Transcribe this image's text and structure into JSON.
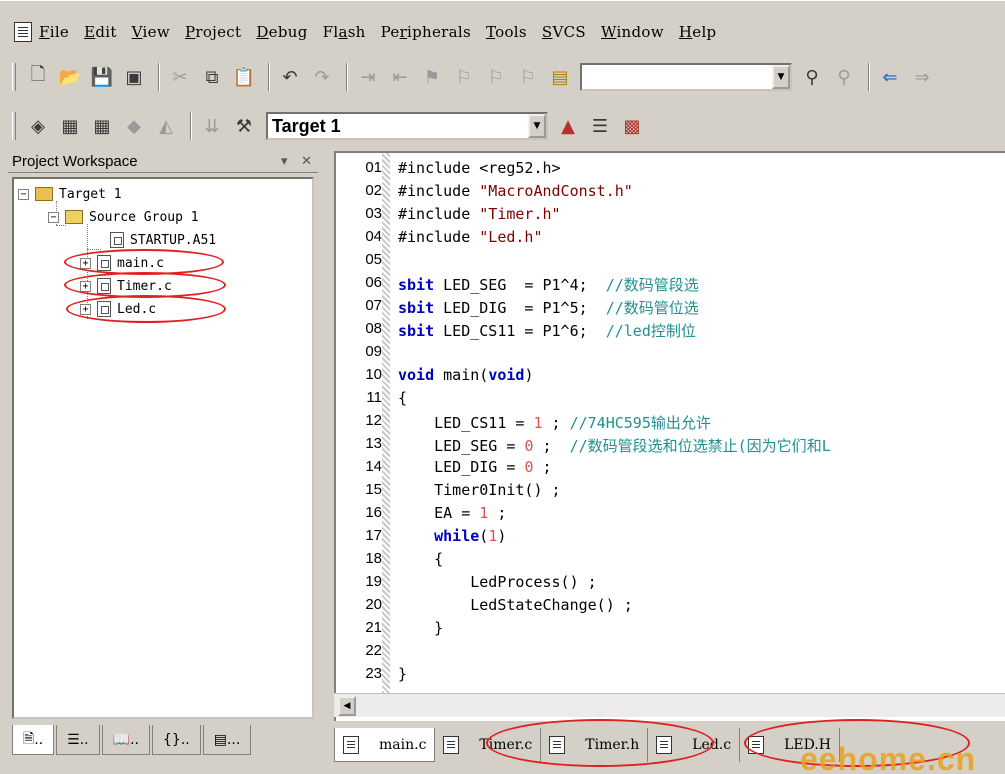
{
  "menu": [
    "File",
    "Edit",
    "View",
    "Project",
    "Debug",
    "Flash",
    "Peripherals",
    "Tools",
    "SVCS",
    "Window",
    "Help"
  ],
  "menu_underline": [
    "F",
    "E",
    "V",
    "P",
    "D",
    "a",
    "r",
    "T",
    "S",
    "W",
    "H"
  ],
  "toolbar2": {
    "target_value": "Target 1"
  },
  "workspace": {
    "title": "Project Workspace",
    "tree": {
      "target": "Target 1",
      "group": "Source Group 1",
      "files": [
        "STARTUP.A51",
        "main.c",
        "Timer.c",
        "Led.c"
      ]
    },
    "tabs": [
      "..",
      "..",
      "..",
      "..",
      "..."
    ]
  },
  "editor": {
    "line_numbers": [
      "01",
      "02",
      "03",
      "04",
      "05",
      "06",
      "07",
      "08",
      "09",
      "10",
      "11",
      "12",
      "13",
      "14",
      "15",
      "16",
      "17",
      "18",
      "19",
      "20",
      "21",
      "22",
      "23"
    ]
  },
  "file_tabs": [
    "main.c",
    "Timer.c",
    "Timer.h",
    "Led.c",
    "LED.H"
  ],
  "watermark": "eehome.cn",
  "colors": {
    "keyword": "#0000c0",
    "string": "#800000",
    "number": "#e05050",
    "comment": "#209090",
    "highlight_ellipse": "#e02020"
  }
}
